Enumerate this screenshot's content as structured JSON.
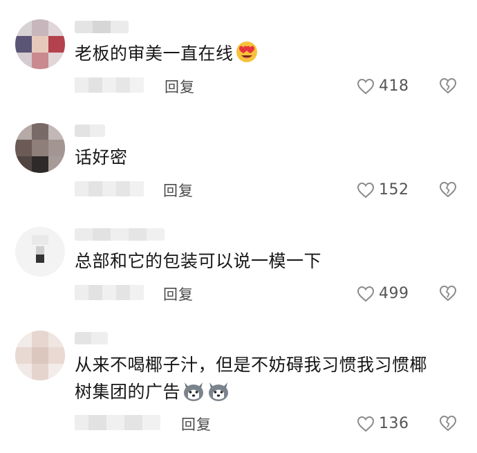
{
  "comments": [
    {
      "id": "c1",
      "text": "老板的审美一直在线",
      "emoji": "heart-eyes-emoji",
      "reply_label": "回复",
      "likes": "418"
    },
    {
      "id": "c2",
      "text": "话好密",
      "reply_label": "回复",
      "likes": "152"
    },
    {
      "id": "c3",
      "text": "总部和它的包装可以说一模一下",
      "reply_label": "回复",
      "likes": "499"
    },
    {
      "id": "c4",
      "text_line1": "从来不喝椰子汁，但是不妨碍我习惯我习惯椰",
      "text_line2": "树集团的广告",
      "emoji": "husky-dog-emoji",
      "reply_label": "回复",
      "likes": "136"
    }
  ],
  "icons": {
    "like": "heart-outline-icon",
    "dislike": "broken-heart-icon"
  },
  "colors": {
    "text": "#161616",
    "meta": "#4b4b4b",
    "icon": "#8a8a8a"
  }
}
